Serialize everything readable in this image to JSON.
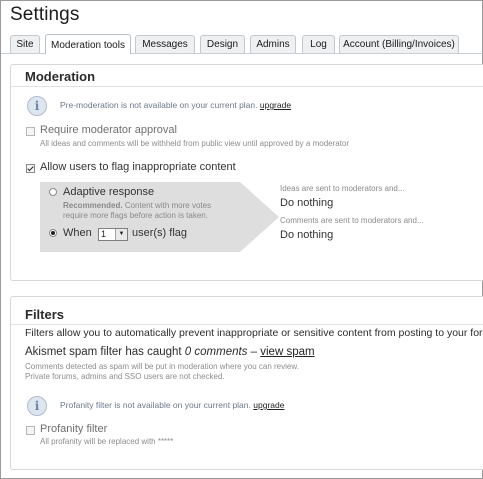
{
  "page": {
    "title": "Settings"
  },
  "tabs": [
    {
      "label": "Site",
      "active": false
    },
    {
      "label": "Moderation tools",
      "active": true
    },
    {
      "label": "Messages",
      "active": false
    },
    {
      "label": "Design",
      "active": false
    },
    {
      "label": "Admins",
      "active": false
    },
    {
      "label": "Log",
      "active": false
    },
    {
      "label": "Account (Billing/Invoices)",
      "active": false
    }
  ],
  "moderation": {
    "title": "Moderation",
    "premod_notice": "Pre-moderation is not available on your current plan.",
    "premod_upgrade": "upgrade",
    "require_approval": {
      "label": "Require moderator approval",
      "desc": "All ideas and comments will be withheld from public view until approved by a moderator",
      "checked": false
    },
    "allow_flag": {
      "label": "Allow users to flag inappropriate content",
      "checked": true
    },
    "adaptive": {
      "label": "Adaptive response",
      "recommended_bold": "Recommended.",
      "recommended_rest": "Content with more votes",
      "recommended_line2": "require more flags before action is taken.",
      "selected": false
    },
    "when": {
      "prefix": "When",
      "value": "1",
      "suffix": "user(s) flag",
      "selected": true
    },
    "ideas_sent": "Ideas are sent to moderators and...",
    "ideas_action": "Do nothing",
    "comments_sent": "Comments are sent to moderators and...",
    "comments_action": "Do nothing"
  },
  "filters": {
    "title": "Filters",
    "intro": "Filters allow you to automatically prevent inappropriate or sensitive content from posting to your forum",
    "akismet_prefix": "Akismet spam filter has caught",
    "akismet_count": "0 comments",
    "akismet_dash": "–",
    "akismet_link": "view spam",
    "akismet_note1": "Comments detected as spam will be put in moderation where you can review.",
    "akismet_note2": "Private forums, admins and SSO users are not checked.",
    "profanity_notice": "Profanity filter is not available on your current plan.",
    "profanity_upgrade": "upgrade",
    "profanity": {
      "label": "Profanity filter",
      "desc": "All profanity will be replaced with *****",
      "checked": false
    }
  },
  "icons": {
    "info": "info-circle-icon",
    "checkbox_check": "checkmark-icon",
    "select_arrow": "triangle-down-icon"
  },
  "colors": {
    "info_icon_bg": "#dde5ef",
    "notice_text": "#6b7a8c",
    "panel_grey": "#dedede"
  }
}
